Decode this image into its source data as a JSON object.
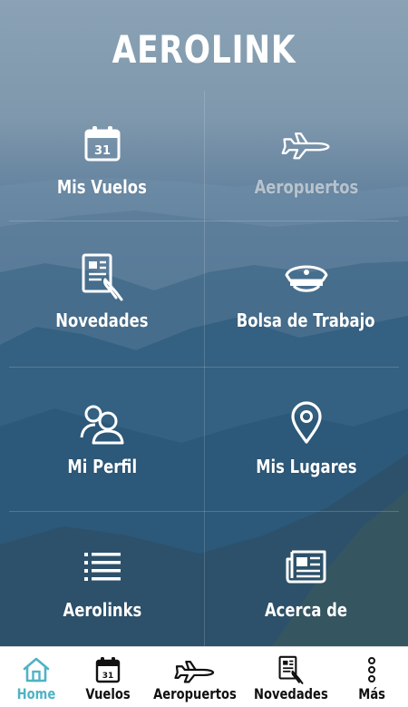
{
  "app": {
    "title": "AEROLINK"
  },
  "menu": [
    {
      "label": "Mis Vuelos",
      "icon": "calendar-icon",
      "calendar_day": "31"
    },
    {
      "label": "Aeropuertos",
      "icon": "airplane-icon"
    },
    {
      "label": "Novedades",
      "icon": "news-hand-icon"
    },
    {
      "label": "Bolsa de Trabajo",
      "icon": "pilot-cap-icon"
    },
    {
      "label": "Mi Perfil",
      "icon": "profile-icon"
    },
    {
      "label": "Mis Lugares",
      "icon": "location-pin-icon"
    },
    {
      "label": "Aerolinks",
      "icon": "list-icon"
    },
    {
      "label": "Acerca de",
      "icon": "newspaper-icon"
    }
  ],
  "tabbar": {
    "active": "Home",
    "tabs": [
      {
        "label": "Home",
        "icon": "home-icon"
      },
      {
        "label": "Vuelos",
        "icon": "calendar-icon",
        "calendar_day": "31"
      },
      {
        "label": "Aeropuertos",
        "icon": "airplane-icon"
      },
      {
        "label": "Novedades",
        "icon": "news-hand-icon"
      },
      {
        "label": "Más",
        "icon": "more-vertical-icon"
      }
    ]
  },
  "colors": {
    "accent": "#4fb3c4",
    "text_on_dark": "#ffffff",
    "tabbar_text": "#111111"
  }
}
